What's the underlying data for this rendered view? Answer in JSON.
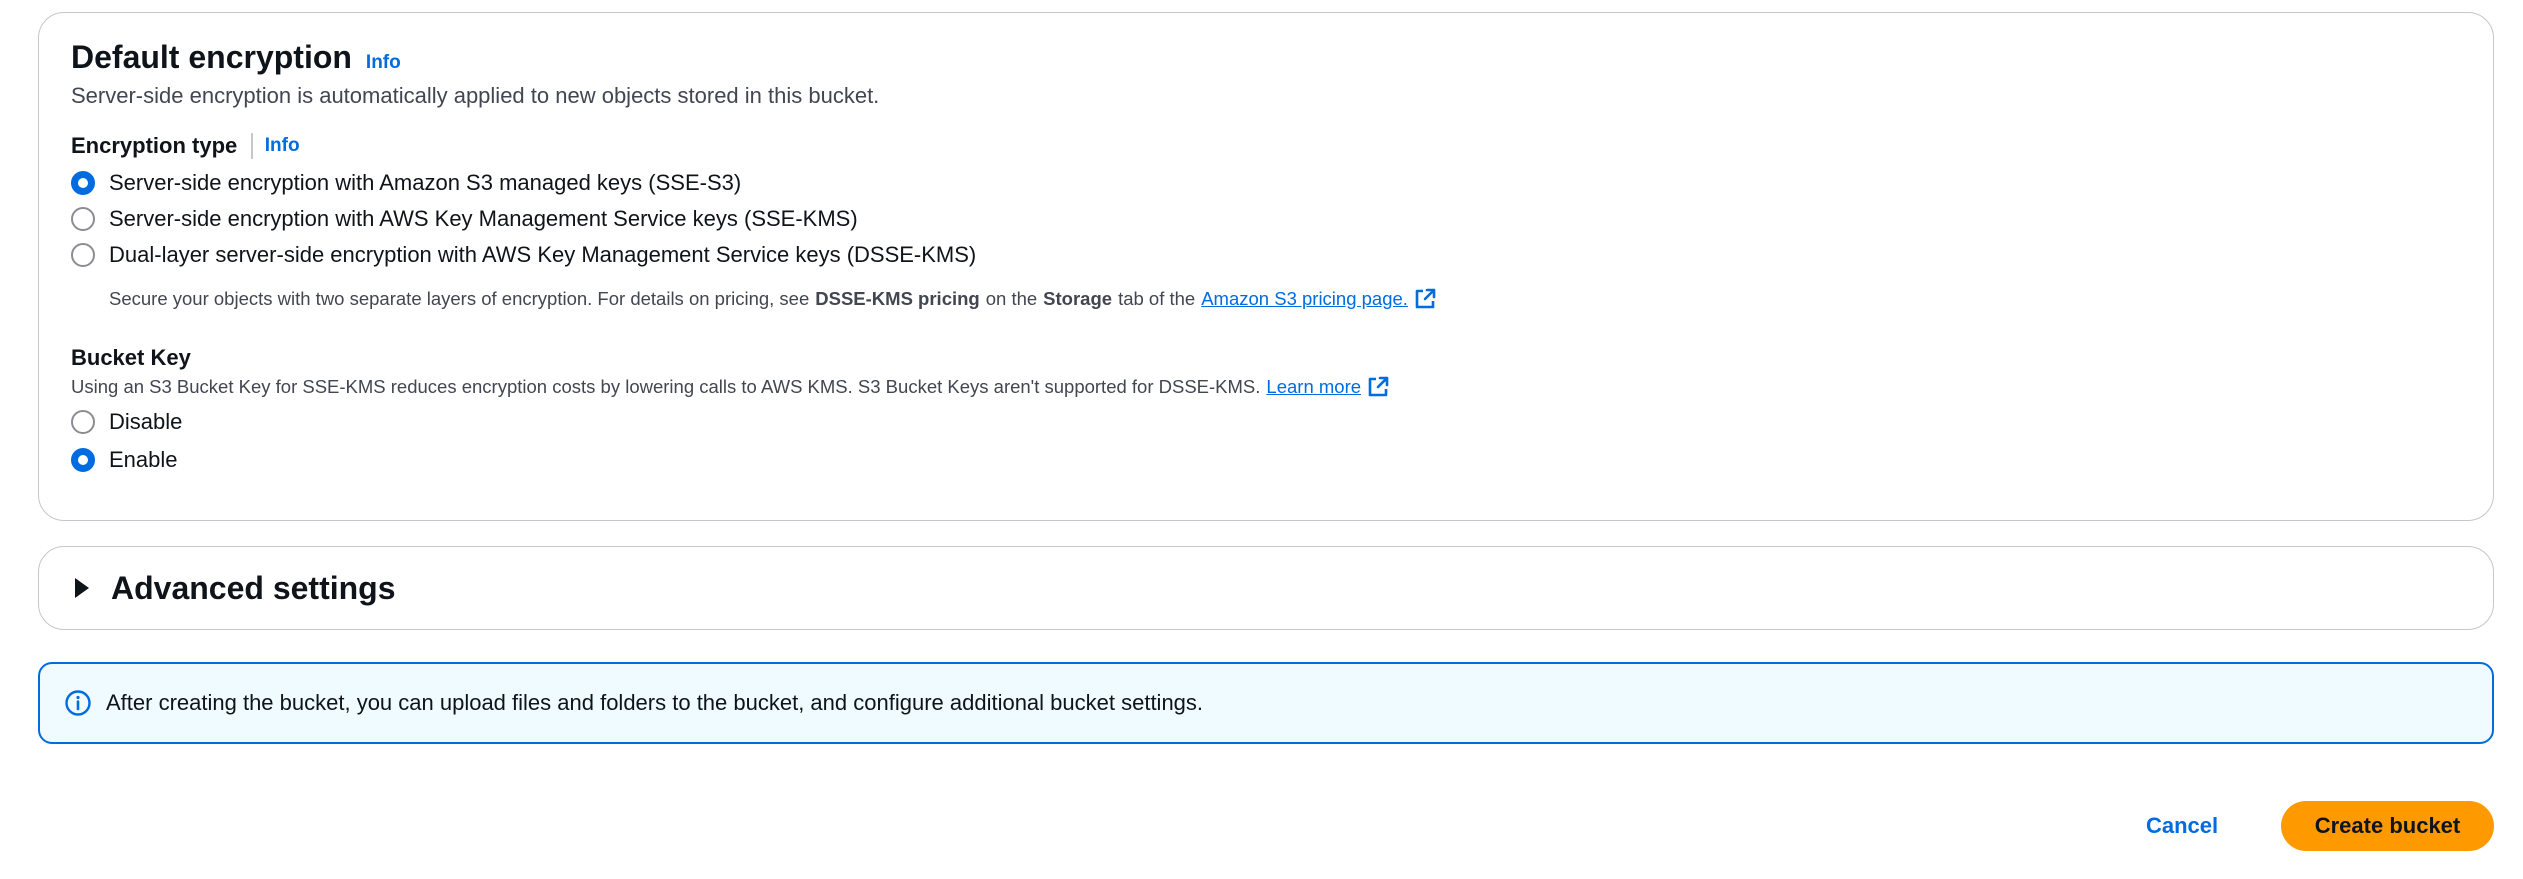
{
  "default_encryption": {
    "title": "Default encryption",
    "info": "Info",
    "description": "Server-side encryption is automatically applied to new objects stored in this bucket.",
    "encryption_type": {
      "label": "Encryption type",
      "info": "Info",
      "options": [
        {
          "label": "Server-side encryption with Amazon S3 managed keys (SSE-S3)",
          "checked": true
        },
        {
          "label": "Server-side encryption with AWS Key Management Service keys (SSE-KMS)",
          "checked": false
        },
        {
          "label": "Dual-layer server-side encryption with AWS Key Management Service keys (DSSE-KMS)",
          "checked": false
        }
      ],
      "dsse_desc_prefix": "Secure your objects with two separate layers of encryption. For details on pricing, see",
      "dsse_desc_bold1": "DSSE-KMS pricing",
      "dsse_desc_mid": "on the",
      "dsse_desc_bold2": "Storage",
      "dsse_desc_suffix": "tab of the",
      "pricing_link": "Amazon S3 pricing page."
    },
    "bucket_key": {
      "label": "Bucket Key",
      "description": "Using an S3 Bucket Key for SSE-KMS reduces encryption costs by lowering calls to AWS KMS. S3 Bucket Keys aren't supported for DSSE-KMS.",
      "learn_more": "Learn more",
      "options": [
        {
          "label": "Disable",
          "checked": false
        },
        {
          "label": "Enable",
          "checked": true
        }
      ]
    }
  },
  "advanced_settings": {
    "title": "Advanced settings",
    "expanded": false
  },
  "alert": {
    "icon": "info-circle-icon",
    "text": "After creating the bucket, you can upload files and folders to the bucket, and configure additional bucket settings."
  },
  "actions": {
    "cancel": "Cancel",
    "create": "Create bucket"
  },
  "colors": {
    "accent": "#006ce0",
    "primary_button": "#ff9900",
    "alert_bg": "#f0fbff"
  }
}
